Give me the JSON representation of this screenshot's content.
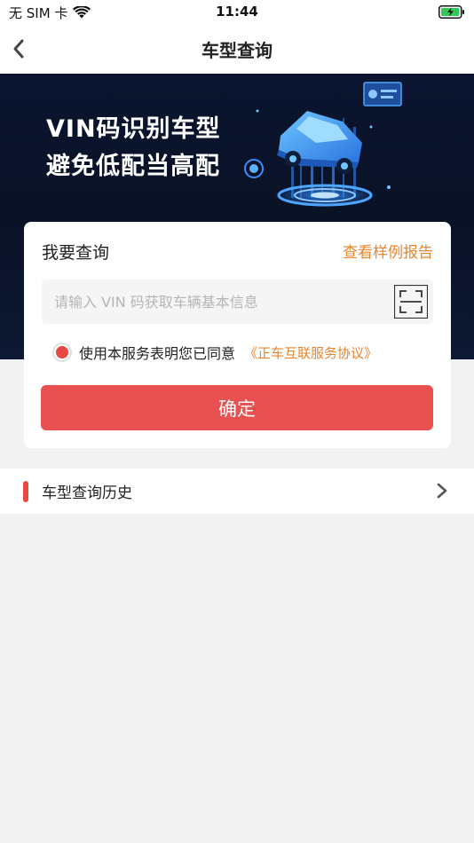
{
  "status_bar": {
    "carrier": "无 SIM 卡",
    "time": "11:44"
  },
  "nav": {
    "title": "车型查询"
  },
  "banner": {
    "line1": "VIN码识别车型",
    "line2": "避免低配当高配"
  },
  "query_card": {
    "title": "我要查询",
    "sample_link": "查看样例报告",
    "vin_placeholder": "请输入 VIN 码获取车辆基本信息",
    "vin_value": "",
    "agree_text": "使用本服务表明您已同意",
    "agreement_link": "《正车互联服务协议》",
    "agree_checked": true,
    "confirm_label": "确定"
  },
  "history": {
    "label": "车型查询历史"
  },
  "colors": {
    "accent_red": "#e95050",
    "link_orange": "#e8852f",
    "banner_dark": "#0b1530",
    "battery_green": "#34c759"
  },
  "icons": {
    "back": "chevron-left-icon",
    "scan": "scan-icon",
    "history_arrow": "chevron-right-icon",
    "wifi": "wifi-icon",
    "battery": "battery-charging-icon"
  }
}
